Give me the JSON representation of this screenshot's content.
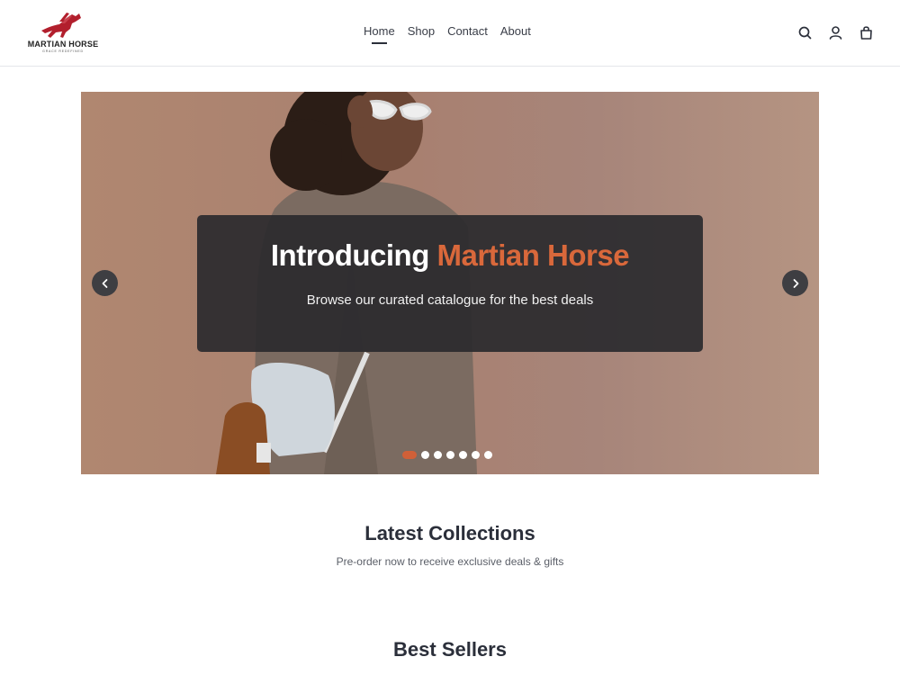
{
  "brand": {
    "name": "MARTIAN HORSE",
    "tagline": "GRACE REDEFINED",
    "logo_color": "#b21f2d"
  },
  "nav": {
    "items": [
      {
        "label": "Home"
      },
      {
        "label": "Shop"
      },
      {
        "label": "Contact"
      },
      {
        "label": "About"
      }
    ],
    "active": "Home"
  },
  "header_icons": [
    "search-icon",
    "user-icon",
    "shopping-bag-icon"
  ],
  "hero": {
    "title_prefix": "Introducing",
    "title_accent": "Martian Horse",
    "subtitle": "Browse our curated catalogue for the best deals",
    "accent_color": "#d9683b",
    "slide_count": 7,
    "active_slide": 1,
    "prev_icon": "chevron-left-icon",
    "next_icon": "chevron-right-icon"
  },
  "latest": {
    "title": "Latest Collections",
    "subtitle": "Pre-order now to receive exclusive deals & gifts"
  },
  "bestsellers": {
    "title": "Best Sellers"
  }
}
